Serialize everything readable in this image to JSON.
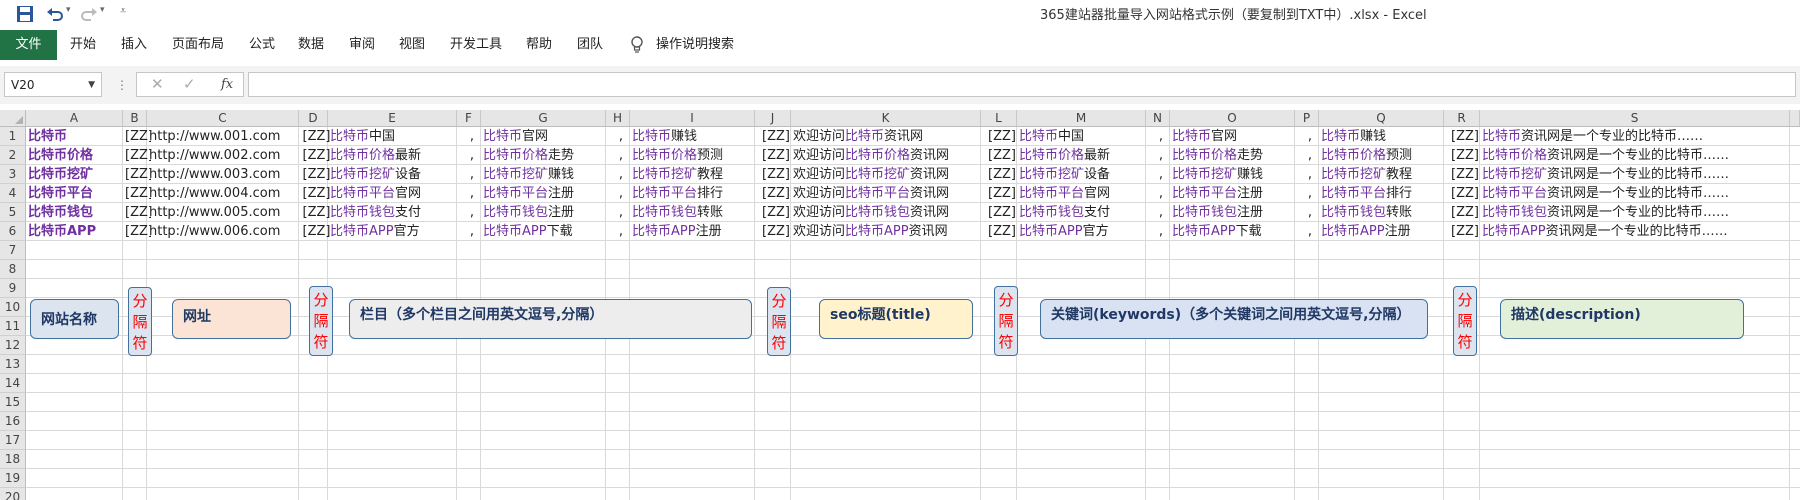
{
  "app": {
    "title": "365建站器批量导入网站格式示例（要复制到TXT中）.xlsx  -  Excel"
  },
  "quick_access": {
    "save_icon": "save-icon",
    "undo_icon": "undo-icon",
    "redo_icon": "redo-icon",
    "customize_icon": "customize-icon"
  },
  "ribbon": {
    "file_tab": "文件",
    "tabs": [
      "开始",
      "插入",
      "页面布局",
      "公式",
      "数据",
      "审阅",
      "视图",
      "开发工具",
      "帮助",
      "团队"
    ],
    "tell_me": "操作说明搜索"
  },
  "formula_bar": {
    "name_box": "V20",
    "formula": ""
  },
  "columns": [
    "A",
    "B",
    "C",
    "D",
    "E",
    "F",
    "G",
    "H",
    "I",
    "J",
    "K",
    "L",
    "M",
    "N",
    "O",
    "P",
    "Q",
    "R",
    "S"
  ],
  "rows": [
    "1",
    "2",
    "3",
    "4",
    "5",
    "6",
    "7",
    "8",
    "9",
    "10",
    "11",
    "12",
    "13",
    "14",
    "15",
    "16",
    "17",
    "18",
    "19",
    "20"
  ],
  "data_rows": [
    {
      "A": "比特币",
      "B": "[ZZ]",
      "C": "http://www.001.com",
      "D": "[ZZ]",
      "E": [
        "比特币",
        "中国"
      ],
      "F": ",",
      "G": [
        "比特币",
        "官网"
      ],
      "H": ",",
      "I": [
        "比特币",
        "赚钱"
      ],
      "J": "[ZZ]",
      "K": [
        "欢迎访问",
        "比特币",
        "资讯网"
      ],
      "L": "[ZZ]",
      "M": [
        "比特币",
        "中国"
      ],
      "N": ",",
      "O": [
        "比特币",
        "官网"
      ],
      "P": ",",
      "Q": [
        "比特币",
        "赚钱"
      ],
      "R": "[ZZ]",
      "S": [
        "比特币",
        "资讯网是一个专业的比特币……"
      ]
    },
    {
      "A": "比特币价格",
      "B": "[ZZ]",
      "C": "http://www.002.com",
      "D": "[ZZ]",
      "E": [
        "比特币价格",
        "最新"
      ],
      "F": ",",
      "G": [
        "比特币价格",
        "走势"
      ],
      "H": ",",
      "I": [
        "比特币价格",
        "预测"
      ],
      "J": "[ZZ]",
      "K": [
        "欢迎访问",
        "比特币价格",
        "资讯网"
      ],
      "L": "[ZZ]",
      "M": [
        "比特币价格",
        "最新"
      ],
      "N": ",",
      "O": [
        "比特币价格",
        "走势"
      ],
      "P": ",",
      "Q": [
        "比特币价格",
        "预测"
      ],
      "R": "[ZZ]",
      "S": [
        "比特币价格",
        "资讯网是一个专业的比特币……"
      ]
    },
    {
      "A": "比特币挖矿",
      "B": "[ZZ]",
      "C": "http://www.003.com",
      "D": "[ZZ]",
      "E": [
        "比特币挖矿",
        "设备"
      ],
      "F": ",",
      "G": [
        "比特币挖矿",
        "赚钱"
      ],
      "H": ",",
      "I": [
        "比特币挖矿",
        "教程"
      ],
      "J": "[ZZ]",
      "K": [
        "欢迎访问",
        "比特币挖矿",
        "资讯网"
      ],
      "L": "[ZZ]",
      "M": [
        "比特币挖矿",
        "设备"
      ],
      "N": ",",
      "O": [
        "比特币挖矿",
        "赚钱"
      ],
      "P": ",",
      "Q": [
        "比特币挖矿",
        "教程"
      ],
      "R": "[ZZ]",
      "S": [
        "比特币挖矿",
        "资讯网是一个专业的比特币……"
      ]
    },
    {
      "A": "比特币平台",
      "B": "[ZZ]",
      "C": "http://www.004.com",
      "D": "[ZZ]",
      "E": [
        "比特币平台",
        "官网"
      ],
      "F": ",",
      "G": [
        "比特币平台",
        "注册"
      ],
      "H": ",",
      "I": [
        "比特币平台",
        "排行"
      ],
      "J": "[ZZ]",
      "K": [
        "欢迎访问",
        "比特币平台",
        "资讯网"
      ],
      "L": "[ZZ]",
      "M": [
        "比特币平台",
        "官网"
      ],
      "N": ",",
      "O": [
        "比特币平台",
        "注册"
      ],
      "P": ",",
      "Q": [
        "比特币平台",
        "排行"
      ],
      "R": "[ZZ]",
      "S": [
        "比特币平台",
        "资讯网是一个专业的比特币……"
      ]
    },
    {
      "A": "比特币钱包",
      "B": "[ZZ]",
      "C": "http://www.005.com",
      "D": "[ZZ]",
      "E": [
        "比特币钱包",
        "支付"
      ],
      "F": ",",
      "G": [
        "比特币钱包",
        "注册"
      ],
      "H": ",",
      "I": [
        "比特币钱包",
        "转账"
      ],
      "J": "[ZZ]",
      "K": [
        "欢迎访问",
        "比特币钱包",
        "资讯网"
      ],
      "L": "[ZZ]",
      "M": [
        "比特币钱包",
        "支付"
      ],
      "N": ",",
      "O": [
        "比特币钱包",
        "注册"
      ],
      "P": ",",
      "Q": [
        "比特币钱包",
        "转账"
      ],
      "R": "[ZZ]",
      "S": [
        "比特币钱包",
        "资讯网是一个专业的比特币……"
      ]
    },
    {
      "A": "比特币APP",
      "B": "[ZZ]",
      "C": "http://www.006.com",
      "D": "[ZZ]",
      "E": [
        "比特币APP",
        "官方"
      ],
      "F": ",",
      "G": [
        "比特币APP",
        "下载"
      ],
      "H": ",",
      "I": [
        "比特币APP",
        "注册"
      ],
      "J": "[ZZ]",
      "K": [
        "欢迎访问",
        "比特币APP",
        "资讯网"
      ],
      "L": "[ZZ]",
      "M": [
        "比特币APP",
        "官方"
      ],
      "N": ",",
      "O": [
        "比特币APP",
        "下载"
      ],
      "P": ",",
      "Q": [
        "比特币APP",
        "注册"
      ],
      "R": "[ZZ]",
      "S": [
        "比特币APP",
        "资讯网是一个专业的比特币……"
      ]
    }
  ],
  "annotations": {
    "site_name": "网站名称",
    "separator": [
      "分",
      "隔",
      "符"
    ],
    "url": "网址",
    "columns": "栏目（多个栏目之间用英文逗号,分隔）",
    "seo_title": "seo标题(title)",
    "keywords": "关键词(keywords)（多个关键词之间用英文逗号,分隔）",
    "description": "描述(description)"
  },
  "colors": {
    "excel_green": "#217346",
    "purple_text": "#7030a0",
    "separator_text": "#ff0000",
    "shape_border": "#41719c",
    "blue_fill": "#dbe4ef",
    "orange_fill": "#fbe4d5",
    "gray_fill": "#ededed",
    "yellow_fill": "#fff2cc",
    "lightblue_fill": "#d9e2f3",
    "green_fill": "#e2efd9"
  }
}
